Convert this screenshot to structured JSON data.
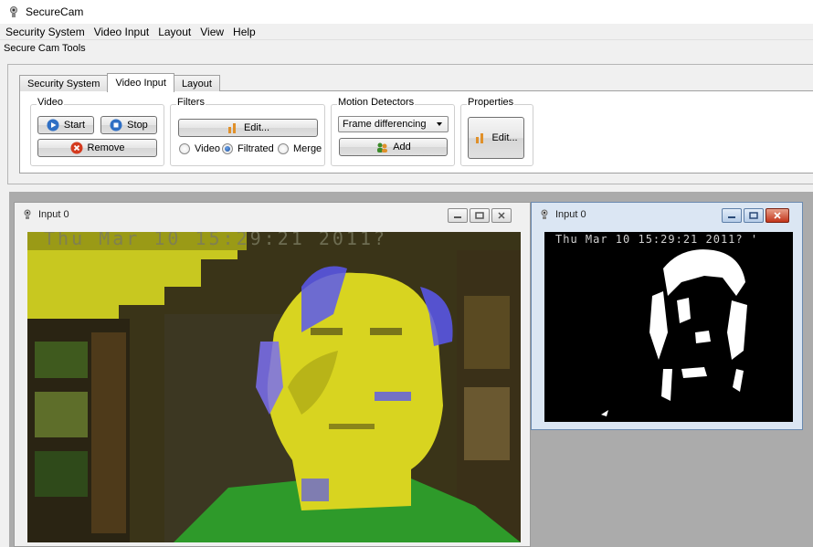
{
  "window": {
    "title": "SecureCam"
  },
  "menu": [
    "Security System",
    "Video Input",
    "Layout",
    "View",
    "Help"
  ],
  "toolbar_title": "Secure Cam Tools",
  "tabs": [
    {
      "label": "Security System",
      "active": false
    },
    {
      "label": "Video Input",
      "active": true
    },
    {
      "label": "Layout",
      "active": false
    }
  ],
  "groups": {
    "video": {
      "title": "Video",
      "start": "Start",
      "stop": "Stop",
      "remove": "Remove"
    },
    "filters": {
      "title": "Filters",
      "edit": "Edit...",
      "radios": [
        {
          "label": "Video",
          "checked": false
        },
        {
          "label": "Filtrated",
          "checked": true
        },
        {
          "label": "Merge",
          "checked": false
        }
      ]
    },
    "motion": {
      "title": "Motion Detectors",
      "selected": "Frame differencing",
      "add": "Add"
    },
    "properties": {
      "title": "Properties",
      "edit": "Edit..."
    }
  },
  "subwindows": [
    {
      "title": "Input 0",
      "overlay_text": "Thu Mar 10 15:29:21 2011?"
    },
    {
      "title": "Input 0",
      "overlay_text": "Thu Mar 10 15:29:21 2011? '"
    }
  ],
  "colors": {
    "accent_blue": "#2f6fc4",
    "danger_red": "#d43a1e",
    "feed_yellow": "#d8d420",
    "feed_blue": "#5a58f0"
  }
}
